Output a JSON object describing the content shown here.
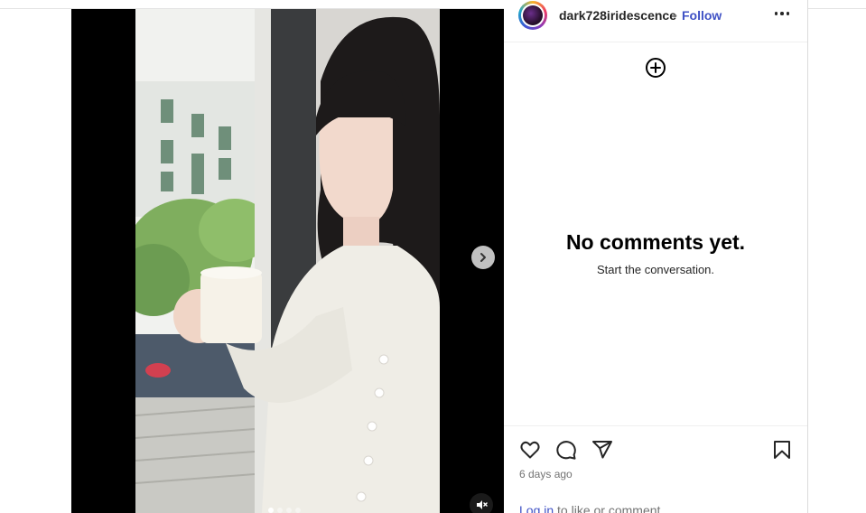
{
  "post": {
    "username": "dark728iridescence",
    "separator": "•",
    "follow_label": "Follow",
    "more_icon": "more-horizontal-icon"
  },
  "comments": {
    "add_icon": "add-circle-icon",
    "empty_title": "No comments yet.",
    "empty_subtitle": "Start the conversation."
  },
  "actions": {
    "like_icon": "heart-icon",
    "comment_icon": "comment-icon",
    "share_icon": "share-icon",
    "save_icon": "bookmark-icon",
    "timestamp": "6 days ago",
    "login_link": "Log in",
    "login_suffix": " to like or comment."
  },
  "media": {
    "next_icon": "chevron-right-icon",
    "mute_icon": "muted-speaker-icon",
    "carousel_index": 1,
    "carousel_count": 4
  },
  "colors": {
    "link": "#3f51c5",
    "text": "#262626",
    "muted": "#737373",
    "media_bg": "#000000"
  }
}
